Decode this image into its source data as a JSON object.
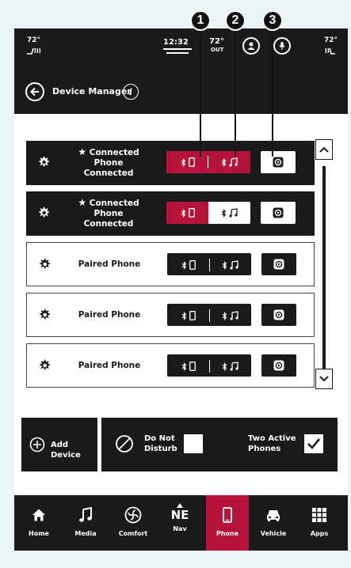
{
  "status": {
    "temp_left": "72°",
    "clock": "12:32",
    "outside_temp": "72°",
    "outside_label": "OUT",
    "temp_right": "72°"
  },
  "header": {
    "title": "Device Manager",
    "info_label": "i"
  },
  "devices": [
    {
      "name": "Connected Phone",
      "status": "Connected"
    },
    {
      "name": "Connected Phone",
      "status": "Connected"
    },
    {
      "name": "Paired Phone",
      "status": ""
    },
    {
      "name": "Paired Phone",
      "status": ""
    },
    {
      "name": "Paired Phone",
      "status": ""
    }
  ],
  "actions": {
    "add_device": "Add Device",
    "dnd_line1": "Do Not",
    "dnd_line2": "Disturb",
    "two_active_line1": "Two Active",
    "two_active_line2": "Phones"
  },
  "nav": [
    "Home",
    "Media",
    "Comfort",
    "Nav",
    "Phone",
    "Vehicle",
    "Apps"
  ],
  "nav_compass": "NE",
  "callouts": [
    "1",
    "2",
    "3"
  ],
  "colors": {
    "accent_red": "#b5133a",
    "panel_black": "#1a1a1a",
    "page_bg": "#e8f4f6"
  }
}
